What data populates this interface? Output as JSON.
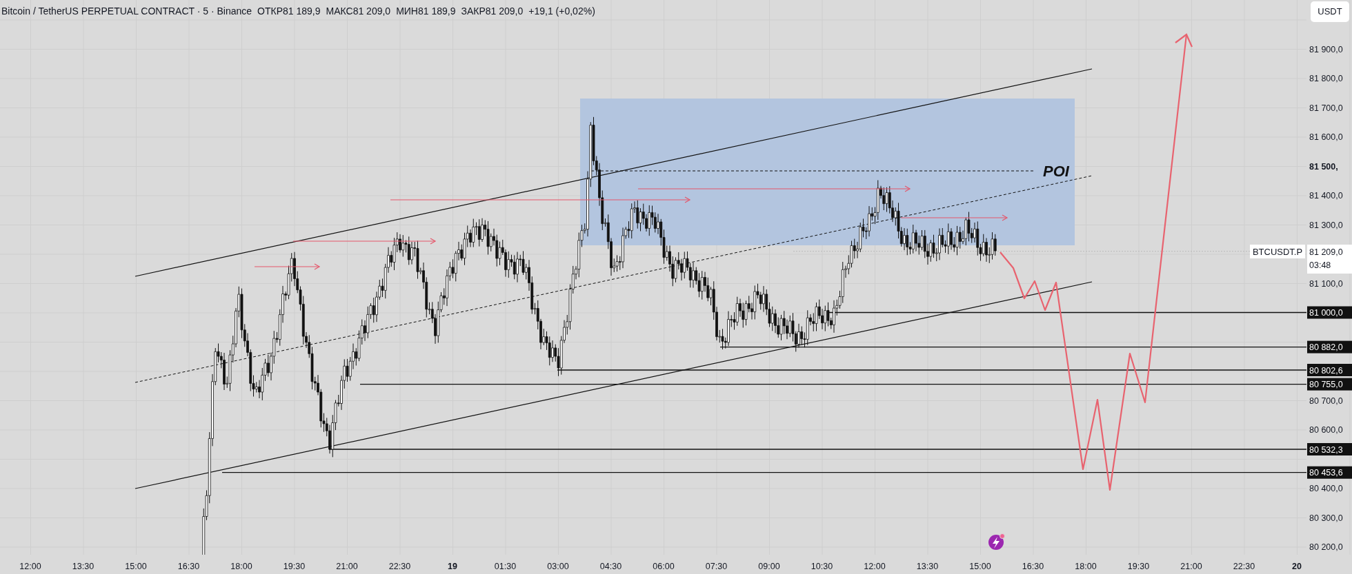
{
  "header": {
    "symbol": "Bitcoin / TetherUS PERPETUAL CONTRACT · 5 · Binance",
    "stats": [
      {
        "label": "ОТКР",
        "value": "81 189,9"
      },
      {
        "label": "МАКС",
        "value": "81 209,0"
      },
      {
        "label": "МИН",
        "value": "81 189,9"
      },
      {
        "label": "ЗАКР",
        "value": "81 209,0"
      }
    ],
    "change": "+19,1 (+0,02%)"
  },
  "currency_button": "USDT",
  "chart": {
    "annotation": "POI",
    "symbol_label": "BTCUSDT.P",
    "current_price": "81 209,0",
    "countdown": "03:48"
  },
  "price_axis": [
    {
      "text": "81 900,0",
      "kind": "normal"
    },
    {
      "text": "81 800,0",
      "kind": "normal"
    },
    {
      "text": "81 700,0",
      "kind": "normal"
    },
    {
      "text": "81 600,0",
      "kind": "normal"
    },
    {
      "text": "81 500,",
      "kind": "bold"
    },
    {
      "text": "81 400,0",
      "kind": "normal"
    },
    {
      "text": "81 300,0",
      "kind": "normal"
    },
    {
      "text": "81 100,0",
      "kind": "normal"
    },
    {
      "text": "80 700,0",
      "kind": "normal"
    },
    {
      "text": "80 600,0",
      "kind": "normal"
    },
    {
      "text": "80 400,0",
      "kind": "normal"
    },
    {
      "text": "80 300,0",
      "kind": "normal"
    },
    {
      "text": "80 200,0",
      "kind": "normal"
    }
  ],
  "level_tags": [
    "81 000,0",
    "80 882,0",
    "80 802,6",
    "80 755,0",
    "80 532,3",
    "80 453,6"
  ],
  "time_axis": [
    {
      "text": "12:00",
      "kind": "time"
    },
    {
      "text": "13:30",
      "kind": "time"
    },
    {
      "text": "15:00",
      "kind": "time"
    },
    {
      "text": "16:30",
      "kind": "time"
    },
    {
      "text": "18:00",
      "kind": "time"
    },
    {
      "text": "19:30",
      "kind": "time"
    },
    {
      "text": "21:00",
      "kind": "time"
    },
    {
      "text": "22:30",
      "kind": "time"
    },
    {
      "text": "19",
      "kind": "day"
    },
    {
      "text": "01:30",
      "kind": "time"
    },
    {
      "text": "03:00",
      "kind": "time"
    },
    {
      "text": "04:30",
      "kind": "time"
    },
    {
      "text": "06:00",
      "kind": "time"
    },
    {
      "text": "07:30",
      "kind": "time"
    },
    {
      "text": "09:00",
      "kind": "time"
    },
    {
      "text": "10:30",
      "kind": "time"
    },
    {
      "text": "12:00",
      "kind": "time"
    },
    {
      "text": "13:30",
      "kind": "time"
    },
    {
      "text": "15:00",
      "kind": "time"
    },
    {
      "text": "16:30",
      "kind": "time"
    },
    {
      "text": "18:00",
      "kind": "time"
    },
    {
      "text": "19:30",
      "kind": "time"
    },
    {
      "text": "21:00",
      "kind": "time"
    },
    {
      "text": "22:30",
      "kind": "time"
    },
    {
      "text": "20",
      "kind": "day"
    }
  ]
}
